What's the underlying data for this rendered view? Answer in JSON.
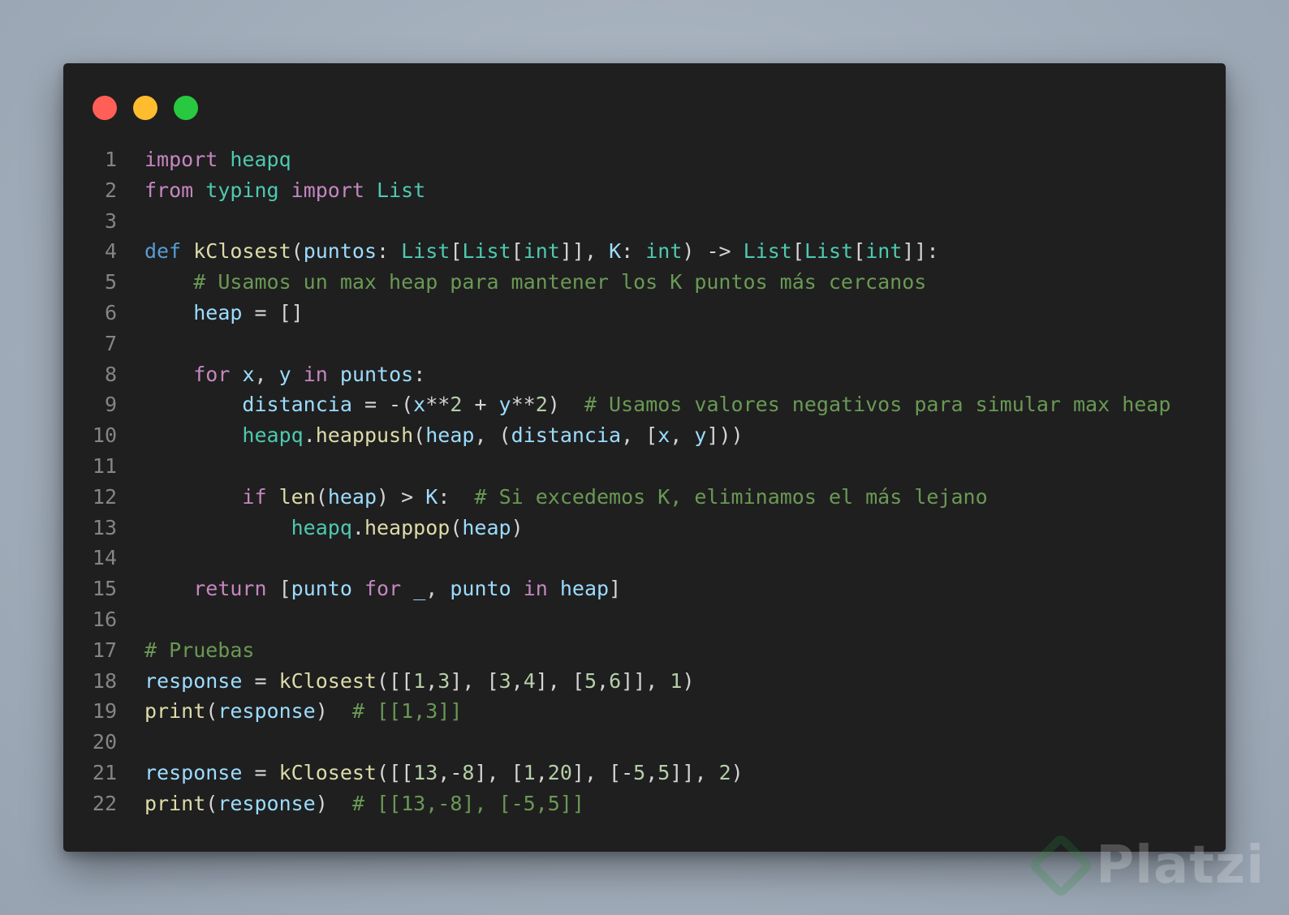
{
  "window": {
    "controls": [
      "close",
      "minimize",
      "maximize"
    ],
    "colors": {
      "close": "#ff5f57",
      "minimize": "#febc2e",
      "maximize": "#28c840",
      "background": "#1f1f1f"
    }
  },
  "code": {
    "language": "python",
    "lines": [
      {
        "n": "1",
        "tokens": [
          [
            "kw",
            "import"
          ],
          [
            "op",
            " "
          ],
          [
            "mod",
            "heapq"
          ]
        ]
      },
      {
        "n": "2",
        "tokens": [
          [
            "kw",
            "from"
          ],
          [
            "op",
            " "
          ],
          [
            "mod",
            "typing"
          ],
          [
            "op",
            " "
          ],
          [
            "kw",
            "import"
          ],
          [
            "op",
            " "
          ],
          [
            "mod",
            "List"
          ]
        ]
      },
      {
        "n": "3",
        "tokens": []
      },
      {
        "n": "4",
        "tokens": [
          [
            "def",
            "def"
          ],
          [
            "op",
            " "
          ],
          [
            "fn",
            "kClosest"
          ],
          [
            "op",
            "("
          ],
          [
            "var",
            "puntos"
          ],
          [
            "op",
            ": "
          ],
          [
            "mod",
            "List"
          ],
          [
            "op",
            "["
          ],
          [
            "mod",
            "List"
          ],
          [
            "op",
            "["
          ],
          [
            "mod",
            "int"
          ],
          [
            "op",
            "]], "
          ],
          [
            "var",
            "K"
          ],
          [
            "op",
            ": "
          ],
          [
            "mod",
            "int"
          ],
          [
            "op",
            ") -> "
          ],
          [
            "mod",
            "List"
          ],
          [
            "op",
            "["
          ],
          [
            "mod",
            "List"
          ],
          [
            "op",
            "["
          ],
          [
            "mod",
            "int"
          ],
          [
            "op",
            "]]:"
          ]
        ]
      },
      {
        "n": "5",
        "tokens": [
          [
            "op",
            "    "
          ],
          [
            "com",
            "# Usamos un max heap para mantener los K puntos más cercanos"
          ]
        ]
      },
      {
        "n": "6",
        "tokens": [
          [
            "op",
            "    "
          ],
          [
            "var",
            "heap"
          ],
          [
            "op",
            " = []"
          ]
        ]
      },
      {
        "n": "7",
        "tokens": []
      },
      {
        "n": "8",
        "tokens": [
          [
            "op",
            "    "
          ],
          [
            "kw",
            "for"
          ],
          [
            "op",
            " "
          ],
          [
            "var",
            "x"
          ],
          [
            "op",
            ", "
          ],
          [
            "var",
            "y"
          ],
          [
            "op",
            " "
          ],
          [
            "kw",
            "in"
          ],
          [
            "op",
            " "
          ],
          [
            "var",
            "puntos"
          ],
          [
            "op",
            ":"
          ]
        ]
      },
      {
        "n": "9",
        "tokens": [
          [
            "op",
            "        "
          ],
          [
            "var",
            "distancia"
          ],
          [
            "op",
            " = -("
          ],
          [
            "var",
            "x"
          ],
          [
            "op",
            "**"
          ],
          [
            "num",
            "2"
          ],
          [
            "op",
            " + "
          ],
          [
            "var",
            "y"
          ],
          [
            "op",
            "**"
          ],
          [
            "num",
            "2"
          ],
          [
            "op",
            ")  "
          ],
          [
            "com",
            "# Usamos valores negativos para simular max heap"
          ]
        ]
      },
      {
        "n": "10",
        "tokens": [
          [
            "op",
            "        "
          ],
          [
            "mod",
            "heapq"
          ],
          [
            "op",
            "."
          ],
          [
            "fn",
            "heappush"
          ],
          [
            "op",
            "("
          ],
          [
            "var",
            "heap"
          ],
          [
            "op",
            ", ("
          ],
          [
            "var",
            "distancia"
          ],
          [
            "op",
            ", ["
          ],
          [
            "var",
            "x"
          ],
          [
            "op",
            ", "
          ],
          [
            "var",
            "y"
          ],
          [
            "op",
            "]))"
          ]
        ]
      },
      {
        "n": "11",
        "tokens": []
      },
      {
        "n": "12",
        "tokens": [
          [
            "op",
            "        "
          ],
          [
            "kw",
            "if"
          ],
          [
            "op",
            " "
          ],
          [
            "fn",
            "len"
          ],
          [
            "op",
            "("
          ],
          [
            "var",
            "heap"
          ],
          [
            "op",
            ") > "
          ],
          [
            "var",
            "K"
          ],
          [
            "op",
            ":  "
          ],
          [
            "com",
            "# Si excedemos K, eliminamos el más lejano"
          ]
        ]
      },
      {
        "n": "13",
        "tokens": [
          [
            "op",
            "            "
          ],
          [
            "mod",
            "heapq"
          ],
          [
            "op",
            "."
          ],
          [
            "fn",
            "heappop"
          ],
          [
            "op",
            "("
          ],
          [
            "var",
            "heap"
          ],
          [
            "op",
            ")"
          ]
        ]
      },
      {
        "n": "14",
        "tokens": []
      },
      {
        "n": "15",
        "tokens": [
          [
            "op",
            "    "
          ],
          [
            "kw",
            "return"
          ],
          [
            "op",
            " ["
          ],
          [
            "var",
            "punto"
          ],
          [
            "op",
            " "
          ],
          [
            "kw",
            "for"
          ],
          [
            "op",
            " "
          ],
          [
            "var",
            "_"
          ],
          [
            "op",
            ", "
          ],
          [
            "var",
            "punto"
          ],
          [
            "op",
            " "
          ],
          [
            "kw",
            "in"
          ],
          [
            "op",
            " "
          ],
          [
            "var",
            "heap"
          ],
          [
            "op",
            "]"
          ]
        ]
      },
      {
        "n": "16",
        "tokens": []
      },
      {
        "n": "17",
        "tokens": [
          [
            "com",
            "# Pruebas"
          ]
        ]
      },
      {
        "n": "18",
        "tokens": [
          [
            "var",
            "response"
          ],
          [
            "op",
            " = "
          ],
          [
            "fn",
            "kClosest"
          ],
          [
            "op",
            "([["
          ],
          [
            "num",
            "1"
          ],
          [
            "op",
            ","
          ],
          [
            "num",
            "3"
          ],
          [
            "op",
            "], ["
          ],
          [
            "num",
            "3"
          ],
          [
            "op",
            ","
          ],
          [
            "num",
            "4"
          ],
          [
            "op",
            "], ["
          ],
          [
            "num",
            "5"
          ],
          [
            "op",
            ","
          ],
          [
            "num",
            "6"
          ],
          [
            "op",
            "]], "
          ],
          [
            "num",
            "1"
          ],
          [
            "op",
            ")"
          ]
        ]
      },
      {
        "n": "19",
        "tokens": [
          [
            "fn",
            "print"
          ],
          [
            "op",
            "("
          ],
          [
            "var",
            "response"
          ],
          [
            "op",
            ")  "
          ],
          [
            "com",
            "# [[1,3]]"
          ]
        ]
      },
      {
        "n": "20",
        "tokens": []
      },
      {
        "n": "21",
        "tokens": [
          [
            "var",
            "response"
          ],
          [
            "op",
            " = "
          ],
          [
            "fn",
            "kClosest"
          ],
          [
            "op",
            "([["
          ],
          [
            "num",
            "13"
          ],
          [
            "op",
            ",-"
          ],
          [
            "num",
            "8"
          ],
          [
            "op",
            "], ["
          ],
          [
            "num",
            "1"
          ],
          [
            "op",
            ","
          ],
          [
            "num",
            "20"
          ],
          [
            "op",
            "], [-"
          ],
          [
            "num",
            "5"
          ],
          [
            "op",
            ","
          ],
          [
            "num",
            "5"
          ],
          [
            "op",
            "]], "
          ],
          [
            "num",
            "2"
          ],
          [
            "op",
            ")"
          ]
        ]
      },
      {
        "n": "22",
        "tokens": [
          [
            "fn",
            "print"
          ],
          [
            "op",
            "("
          ],
          [
            "var",
            "response"
          ],
          [
            "op",
            ") "
          ],
          [
            "com",
            " # [[13,-8], [-5,5]]"
          ]
        ]
      }
    ]
  },
  "watermark": {
    "text": "Platzi"
  }
}
